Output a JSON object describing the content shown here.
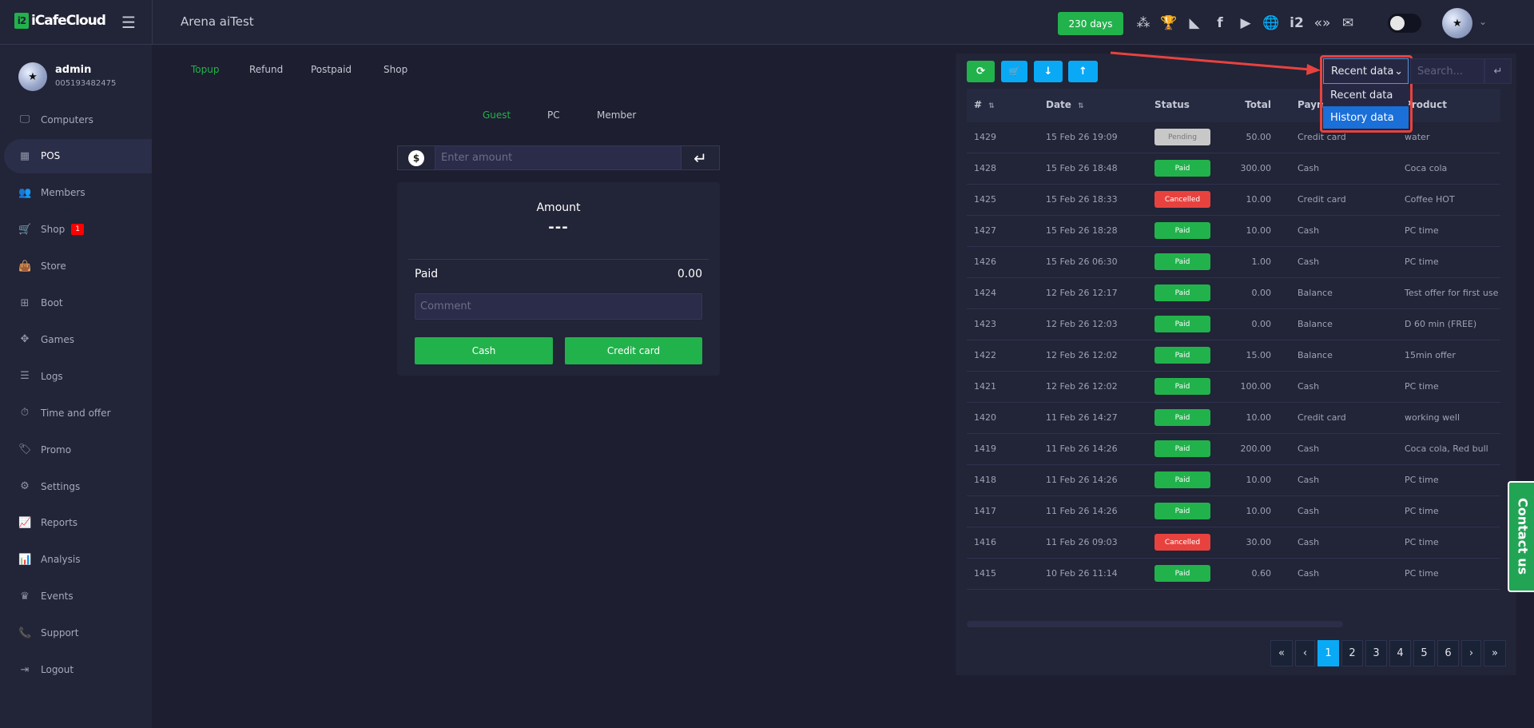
{
  "header": {
    "logo": "iCafeCloud",
    "logo_mark": "i2",
    "site_name": "Arena aiTest",
    "license_days": "230 days",
    "icons": [
      "ranking-icon",
      "trophy-icon",
      "rss-icon",
      "facebook-icon",
      "youtube-icon",
      "globe-icon",
      "icafe-icon",
      "brand-icon",
      "mail-icon"
    ]
  },
  "user": {
    "name": "admin",
    "id": "005193482475"
  },
  "sidebar": {
    "items": [
      {
        "label": "Computers",
        "icon": "🖵"
      },
      {
        "label": "POS",
        "icon": "▦"
      },
      {
        "label": "Members",
        "icon": "👥"
      },
      {
        "label": "Shop",
        "icon": "🛒",
        "badge": "1"
      },
      {
        "label": "Store",
        "icon": "👜"
      },
      {
        "label": "Boot",
        "icon": "⊞"
      },
      {
        "label": "Games",
        "icon": "✥"
      },
      {
        "label": "Logs",
        "icon": "☰"
      },
      {
        "label": "Time and offer",
        "icon": "⏱"
      },
      {
        "label": "Promo",
        "icon": "🏷"
      },
      {
        "label": "Settings",
        "icon": "⚙"
      },
      {
        "label": "Reports",
        "icon": "📈"
      },
      {
        "label": "Analysis",
        "icon": "📊"
      },
      {
        "label": "Events",
        "icon": "♛"
      },
      {
        "label": "Support",
        "icon": "📞"
      },
      {
        "label": "Logout",
        "icon": "⇥"
      }
    ],
    "active": "POS"
  },
  "pos": {
    "tabs": [
      "Topup",
      "Refund",
      "Postpaid",
      "Shop"
    ],
    "subtabs": [
      "Guest",
      "PC",
      "Member"
    ],
    "amount_placeholder": "Enter amount",
    "currency_symbol": "$",
    "enter_symbol": "↵",
    "amount_label": "Amount",
    "amount_value": "---",
    "paid_label": "Paid",
    "paid_value": "0.00",
    "comment_placeholder": "Comment",
    "cash_button": "Cash",
    "credit_button": "Credit card"
  },
  "orders": {
    "toolbar": {
      "refresh": "⟳",
      "cart": "🛒",
      "down": "↓",
      "up": "↑"
    },
    "select": {
      "value": "Recent data",
      "chevron": "⌄",
      "options": [
        "Recent data",
        "History data"
      ],
      "highlighted": "History data"
    },
    "search_placeholder": "Search...",
    "search_enter": "↵",
    "columns": [
      "#",
      "Date",
      "Status",
      "Total",
      "Payment",
      "Product"
    ],
    "sort_symbol": "⇅",
    "rows": [
      {
        "id": "1429",
        "date": "15 Feb 26 19:09",
        "status": "Pending",
        "total": "50.00",
        "payment": "Credit card",
        "product": "water"
      },
      {
        "id": "1428",
        "date": "15 Feb 26 18:48",
        "status": "Paid",
        "total": "300.00",
        "payment": "Cash",
        "product": "Coca cola"
      },
      {
        "id": "1425",
        "date": "15 Feb 26 18:33",
        "status": "Cancelled",
        "total": "10.00",
        "payment": "Credit card",
        "product": "Coffee HOT"
      },
      {
        "id": "1427",
        "date": "15 Feb 26 18:28",
        "status": "Paid",
        "total": "10.00",
        "payment": "Cash",
        "product": "PC time"
      },
      {
        "id": "1426",
        "date": "15 Feb 26 06:30",
        "status": "Paid",
        "total": "1.00",
        "payment": "Cash",
        "product": "PC time"
      },
      {
        "id": "1424",
        "date": "12 Feb 26 12:17",
        "status": "Paid",
        "total": "0.00",
        "payment": "Balance",
        "product": "Test offer for first use"
      },
      {
        "id": "1423",
        "date": "12 Feb 26 12:03",
        "status": "Paid",
        "total": "0.00",
        "payment": "Balance",
        "product": "D 60 min (FREE)"
      },
      {
        "id": "1422",
        "date": "12 Feb 26 12:02",
        "status": "Paid",
        "total": "15.00",
        "payment": "Balance",
        "product": "15min offer"
      },
      {
        "id": "1421",
        "date": "12 Feb 26 12:02",
        "status": "Paid",
        "total": "100.00",
        "payment": "Cash",
        "product": "PC time"
      },
      {
        "id": "1420",
        "date": "11 Feb 26 14:27",
        "status": "Paid",
        "total": "10.00",
        "payment": "Credit card",
        "product": "working well"
      },
      {
        "id": "1419",
        "date": "11 Feb 26 14:26",
        "status": "Paid",
        "total": "200.00",
        "payment": "Cash",
        "product": "Coca cola, Red bull"
      },
      {
        "id": "1418",
        "date": "11 Feb 26 14:26",
        "status": "Paid",
        "total": "10.00",
        "payment": "Cash",
        "product": "PC time"
      },
      {
        "id": "1417",
        "date": "11 Feb 26 14:26",
        "status": "Paid",
        "total": "10.00",
        "payment": "Cash",
        "product": "PC time"
      },
      {
        "id": "1416",
        "date": "11 Feb 26 09:03",
        "status": "Cancelled",
        "total": "30.00",
        "payment": "Cash",
        "product": "PC time"
      },
      {
        "id": "1415",
        "date": "10 Feb 26 11:14",
        "status": "Paid",
        "total": "0.60",
        "payment": "Cash",
        "product": "PC time"
      }
    ],
    "status_colors": {
      "Paid": "#22b24c",
      "Pending": "#c8c8c8",
      "Cancelled": "#e8423f"
    },
    "pagination": {
      "first": "«",
      "prev": "‹",
      "pages": [
        "1",
        "2",
        "3",
        "4",
        "5",
        "6"
      ],
      "current": "1",
      "next": "›",
      "last": "»"
    }
  },
  "contact_us": "Contact us",
  "colors": {
    "accent_green": "#22b24c",
    "accent_blue": "#0aa9f5",
    "annotation_red": "#e8423f"
  }
}
